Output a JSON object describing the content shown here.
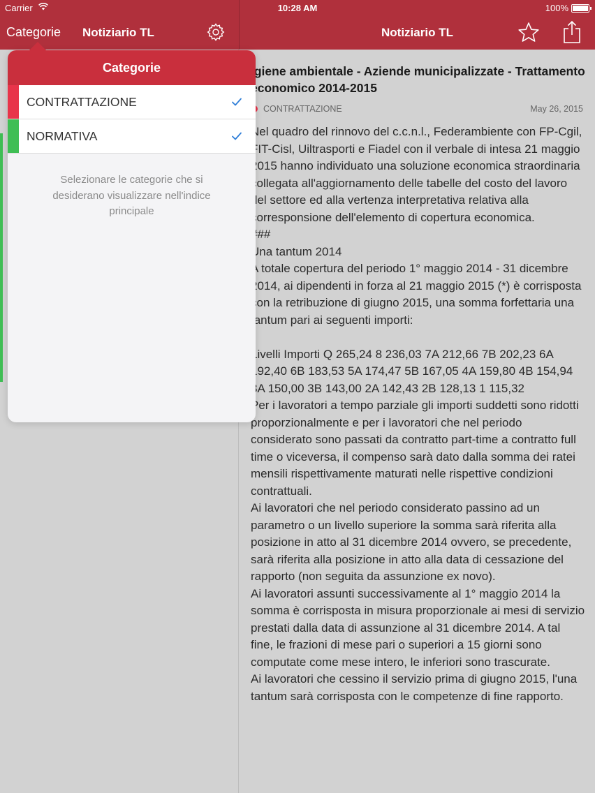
{
  "status_bar": {
    "carrier": "Carrier",
    "time": "10:28 AM",
    "battery": "100%"
  },
  "nav": {
    "left_button": "Categorie",
    "left_title": "Notiziario TL",
    "right_title": "Notiziario TL",
    "icons": [
      "gear-icon",
      "star-icon",
      "share-icon"
    ]
  },
  "popover": {
    "title": "Categorie",
    "items": [
      {
        "label": "CONTRATTAZIONE",
        "color": "#e8344a",
        "checked": true
      },
      {
        "label": "NORMATIVA",
        "color": "#3fbe54",
        "checked": true
      }
    ],
    "footer": "Selezionare le categorie che si desiderano visualizzare nell'indice principale"
  },
  "article": {
    "title": "igiene ambientale - Aziende municipalizzate - Trattamento economico 2014-2015",
    "category": "CONTRATTAZIONE",
    "category_color": "#e8344a",
    "date": "May 26, 2015",
    "body": "Nel quadro del rinnovo del c.c.n.l., Federambiente con FP-Cgil, FIT-Cisl, Uiltrasporti e Fiadel con il verbale di intesa 21 maggio 2015 hanno individuato una soluzione economica straordinaria collegata all'aggiornamento delle tabelle del costo del lavoro del settore ed alla vertenza interpretativa relativa alla corresponsione dell'elemento di copertura economica.\n###\nUna tantum 2014\nA totale copertura del periodo 1° maggio 2014 - 31 dicembre 2014, ai dipendenti in forza al 21 maggio 2015 (*) è corrisposta con la retribuzione di giugno 2015, una somma forfettaria una tantum pari ai seguenti importi:\n\nLivelli Importi Q 265,24 8 236,03 7A 212,66 7B 202,23 6A 192,40 6B 183,53 5A 174,47 5B 167,05 4A 159,80 4B 154,94 3A 150,00 3B 143,00 2A 142,43 2B 128,13 1 115,32\nPer i lavoratori a tempo parziale gli importi suddetti sono ridotti proporzionalmente e per i lavoratori che nel periodo considerato sono passati da contratto part-time a contratto full time o viceversa, il compenso sarà dato dalla somma dei ratei mensili rispettivamente maturati nelle rispettive condizioni contrattuali.\nAi lavoratori che nel periodo considerato passino ad un parametro o un livello superiore la somma sarà riferita alla posizione in atto al 31 dicembre 2014 ovvero, se precedente, sarà riferita alla posizione in atto alla data di cessazione del rapporto (non seguita da assunzione ex novo).\nAi lavoratori assunti successivamente al 1° maggio 2014 la somma è corrisposta in misura proporzionale ai mesi di servizio prestati dalla data di assunzione al 31 dicembre 2014. A tal fine, le frazioni di mese pari o superiori a 15 giorni sono computate come mese intero, le inferiori sono trascurate.\nAi lavoratori che cessino il servizio prima di giugno 2015, l'una tantum sarà corrisposta con le competenze di fine rapporto."
  },
  "colors": {
    "nav_bar": "#b0303c",
    "popover_header": "#c92f3d",
    "check": "#2f7ed8"
  }
}
